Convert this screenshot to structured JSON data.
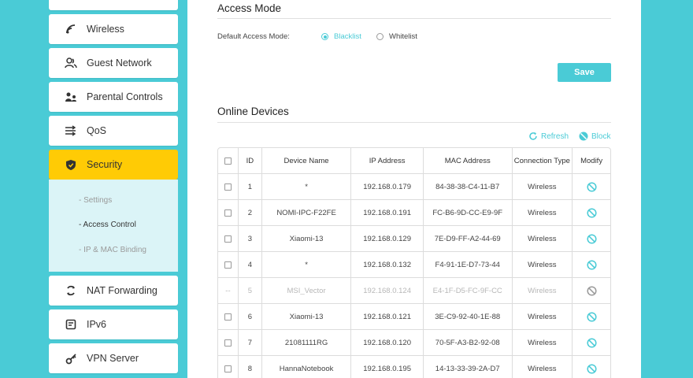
{
  "sidebar": {
    "items": [
      {
        "label": "Wireless",
        "icon": "wifi-icon"
      },
      {
        "label": "Guest Network",
        "icon": "guest-network-icon"
      },
      {
        "label": "Parental Controls",
        "icon": "parental-controls-icon"
      },
      {
        "label": "QoS",
        "icon": "qos-icon"
      },
      {
        "label": "Security",
        "icon": "shield-icon",
        "active": true
      },
      {
        "label": "NAT Forwarding",
        "icon": "nat-forwarding-icon"
      },
      {
        "label": "IPv6",
        "icon": "ipv6-icon"
      },
      {
        "label": "VPN Server",
        "icon": "vpn-key-icon"
      }
    ],
    "submenu": [
      {
        "label": "- Settings"
      },
      {
        "label": "- Access Control",
        "active": true
      },
      {
        "label": "- IP & MAC Binding"
      }
    ]
  },
  "access_mode": {
    "title": "Access Mode",
    "label": "Default Access Mode:",
    "options": [
      {
        "label": "Blacklist",
        "selected": true
      },
      {
        "label": "Whitelist",
        "selected": false
      }
    ],
    "save_label": "Save"
  },
  "online_devices": {
    "title": "Online Devices",
    "refresh_label": "Refresh",
    "block_label": "Block",
    "columns": [
      "ID",
      "Device Name",
      "IP Address",
      "MAC Address",
      "Connection Type",
      "Modify"
    ],
    "rows": [
      {
        "id": "1",
        "name": "*",
        "ip": "192.168.0.179",
        "mac": "84-38-38-C4-11-B7",
        "type": "Wireless",
        "blocked": false
      },
      {
        "id": "2",
        "name": "NOMI-IPC-F22FE",
        "ip": "192.168.0.191",
        "mac": "FC-B6-9D-CC-E9-9F",
        "type": "Wireless",
        "blocked": false
      },
      {
        "id": "3",
        "name": "Xiaomi-13",
        "ip": "192.168.0.129",
        "mac": "7E-D9-FF-A2-44-69",
        "type": "Wireless",
        "blocked": false
      },
      {
        "id": "4",
        "name": "*",
        "ip": "192.168.0.132",
        "mac": "F4-91-1E-D7-73-44",
        "type": "Wireless",
        "blocked": false
      },
      {
        "id": "5",
        "name": "MSI_Vector",
        "ip": "192.168.0.124",
        "mac": "E4-1F-D5-FC-9F-CC",
        "type": "Wireless",
        "blocked": false,
        "disabled": true,
        "check": "--"
      },
      {
        "id": "6",
        "name": "Xiaomi-13",
        "ip": "192.168.0.121",
        "mac": "3E-C9-92-40-1E-88",
        "type": "Wireless",
        "blocked": false
      },
      {
        "id": "7",
        "name": "21081111RG",
        "ip": "192.168.0.120",
        "mac": "70-5F-A3-B2-92-08",
        "type": "Wireless",
        "blocked": false
      },
      {
        "id": "8",
        "name": "HannaNotebook",
        "ip": "192.168.0.195",
        "mac": "14-13-33-39-2A-D7",
        "type": "Wireless",
        "blocked": false
      }
    ]
  },
  "colors": {
    "accent": "#4acbd6",
    "active": "#ffcb05",
    "submenu_bg": "#dbf4f7"
  }
}
